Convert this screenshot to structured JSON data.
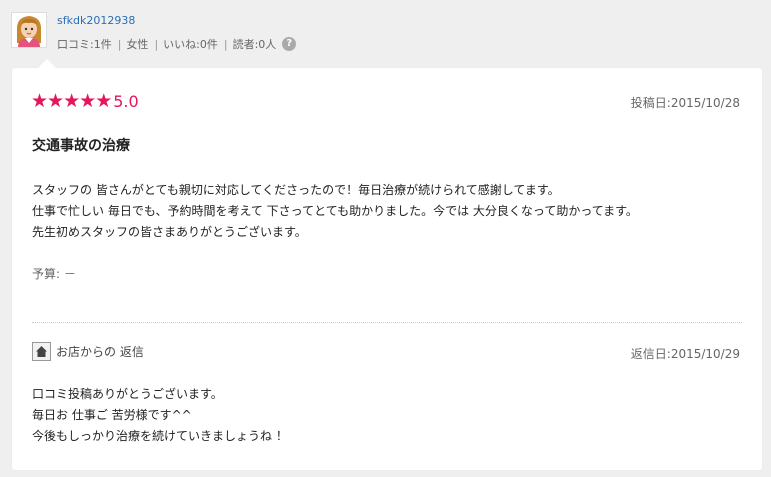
{
  "user": {
    "name": "sfkdk2012938",
    "stats": [
      "口コミ:1件",
      "女性",
      "いいね:0件",
      "読者:0人"
    ],
    "help_icon": "?"
  },
  "review": {
    "stars": [
      "★",
      "★",
      "★",
      "★",
      "★"
    ],
    "rating": "5.0",
    "rating_value": 5,
    "post_date": "投稿日:2015/10/28",
    "title": "交通事故の治療",
    "body": [
      "スタッフの 皆さんがとても親切に対応してくださったので！毎日治療が続けられて感謝してます。",
      "仕事で忙しい 毎日でも、予約時間を考えて 下さってとても助かりました。今では 大分良くなって助かってます。",
      "先生初めスタッフの皆さまありがとうございます。"
    ],
    "budget": "予算: －"
  },
  "reply": {
    "label": "お店からの 返信",
    "date": "返信日:2015/10/29",
    "body": [
      "口コミ投稿ありがとうございます。",
      "毎日お 仕事ご 苦労様です^^",
      "今後もしっかり治療を続けていきましょうね ！"
    ]
  },
  "colors": {
    "accent": "#e6155c",
    "link": "#2a6fb3",
    "background": "#efefef"
  },
  "icons": {
    "avatar": "avatar-girl-icon",
    "shop": "house-icon",
    "help": "question-circle-icon"
  }
}
